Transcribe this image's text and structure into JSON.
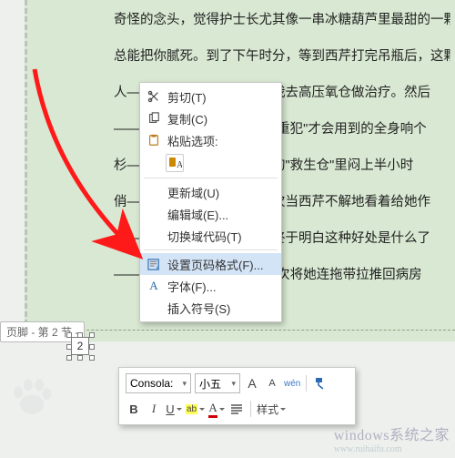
{
  "doc": {
    "lines": [
      "奇怪的念头，觉得护士长尤其像一串冰糖葫芦里最甜的一颗",
      "总能把你腻死。到了下午时分，等到西芹打完吊瓶后，这颗糖",
      "人————————备，随我去高压氧仓做治疗。然后",
      "—————————有押送\"重犯\"才会用到的全身响个",
      "杉————————钻进去的\"救生仓\"里闷上半小时",
      "俏————————，有一次当西芹不解地看着给她作",
      "什————————，西芹终于明白这种好处是什么了",
      "—————————仑椅\"再次将她连拖带拉推回病房",
      ""
    ]
  },
  "footer": {
    "label": "页脚 - 第 2 节 -",
    "page_number": "2"
  },
  "context_menu": {
    "cut": "剪切(T)",
    "copy": "复制(C)",
    "paste_options": "粘贴选项:",
    "paste_icon": "A",
    "update_field": "更新域(U)",
    "edit_field": "编辑域(E)...",
    "toggle_field": "切换域代码(T)",
    "page_number_format": "设置页码格式(F)...",
    "font": "字体(F)...",
    "insert_symbol": "插入符号(S)"
  },
  "mini_toolbar": {
    "font_name": "Consola:",
    "font_size": "小五",
    "grow": "A",
    "shrink": "A",
    "wen": "wén",
    "bold": "B",
    "italic": "I",
    "underline": "U",
    "highlight": "ab",
    "fontcolor": "A",
    "styles": "样式"
  },
  "watermark": {
    "brand": "windows系统之家",
    "url": "www.ruihaifu.com"
  }
}
